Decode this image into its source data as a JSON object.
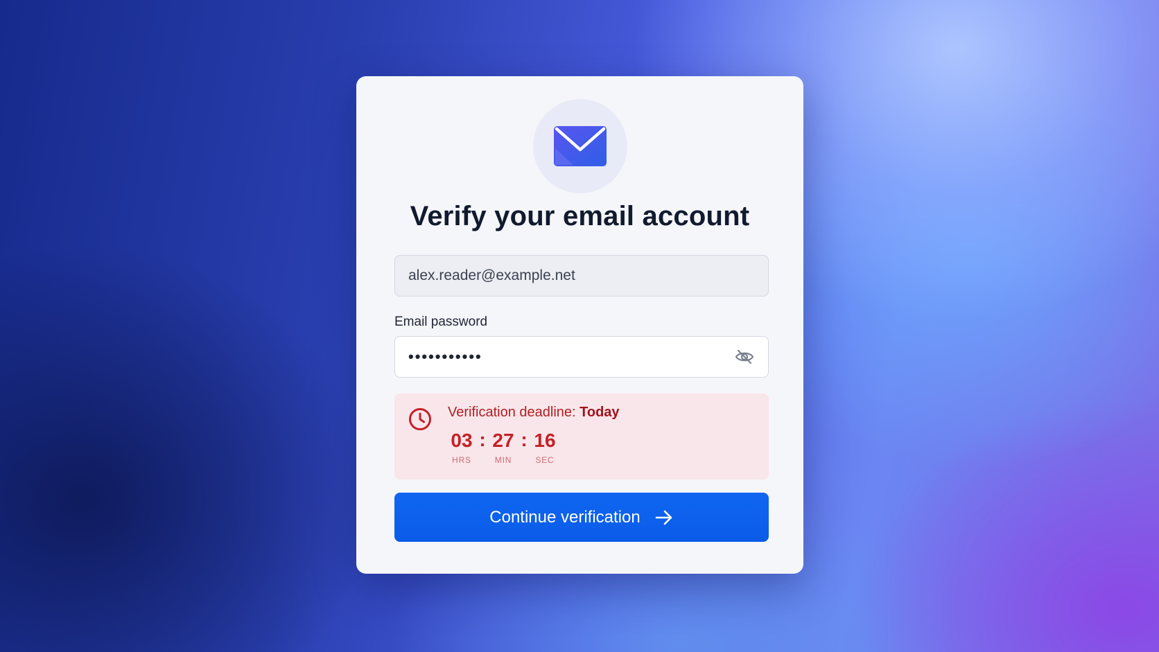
{
  "card": {
    "icon": "envelope-icon",
    "title": "Verify your email account"
  },
  "email": {
    "value": "alex.reader@example.net"
  },
  "password": {
    "label": "Email password",
    "masked_value": "•••••••••••",
    "toggle_icon": "eye-off-icon"
  },
  "deadline": {
    "icon": "clock-icon",
    "prefix": "Verification deadline:",
    "emphasis": "Today",
    "hours": "03",
    "minutes": "27",
    "seconds": "16",
    "separator": ":",
    "hours_label": "HRS",
    "minutes_label": "MIN",
    "seconds_label": "SEC"
  },
  "actions": {
    "continue_label": "Continue verification",
    "continue_icon": "arrow-right-icon"
  },
  "colors": {
    "primary": "#0a5ce8",
    "alert_text": "#b01e23",
    "alert_bg": "#f9e6ea",
    "title": "#121a2e"
  }
}
